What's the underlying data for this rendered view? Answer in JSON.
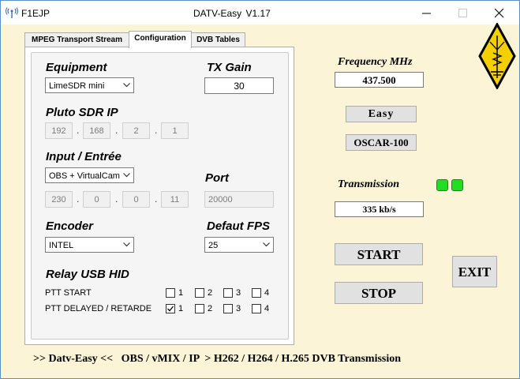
{
  "window": {
    "callsign": "F1EJP",
    "title": "DATV-Easy   V1.17"
  },
  "tabs": [
    {
      "label": "MPEG Transport Stream"
    },
    {
      "label": "Configuration"
    },
    {
      "label": "DVB Tables"
    }
  ],
  "config": {
    "equipment_label": "Equipment",
    "equipment_value": "LimeSDR mini",
    "tx_gain_label": "TX Gain",
    "tx_gain_value": "30",
    "pluto_label": "Pluto SDR IP",
    "pluto_ip": [
      "192",
      "168",
      "2",
      "1"
    ],
    "input_label": "Input / Entrée",
    "input_value": "OBS + VirtualCam",
    "port_label": "Port",
    "input_ip": [
      "230",
      "0",
      "0",
      "11"
    ],
    "port_value": "20000",
    "encoder_label": "Encoder",
    "encoder_value": "INTEL",
    "fps_label": "Defaut FPS",
    "fps_value": "25",
    "relay_label": "Relay USB HID",
    "ptt_start_label": "PTT START",
    "ptt_delayed_label": "PTT DELAYED / RETARDE",
    "relay_numbers": [
      "1",
      "2",
      "3",
      "4"
    ],
    "ptt_start_checked": [
      false,
      false,
      false,
      false
    ],
    "ptt_delayed_checked": [
      true,
      false,
      false,
      false
    ]
  },
  "right": {
    "frequency_label": "Frequency MHz",
    "frequency_value": "437.500",
    "mode_label": "Easy",
    "satellite_label": "OSCAR-100",
    "transmission_label": "Transmission",
    "bitrate_value": "335 kb/s",
    "start_label": "START",
    "stop_label": "STOP",
    "exit_label": "EXIT",
    "led_color": "#22dd22"
  },
  "footer": {
    "text": ">> Datv-Easy <<   OBS / vMIX / IP  > H262 / H264 / H.265 DVB Transmission"
  }
}
